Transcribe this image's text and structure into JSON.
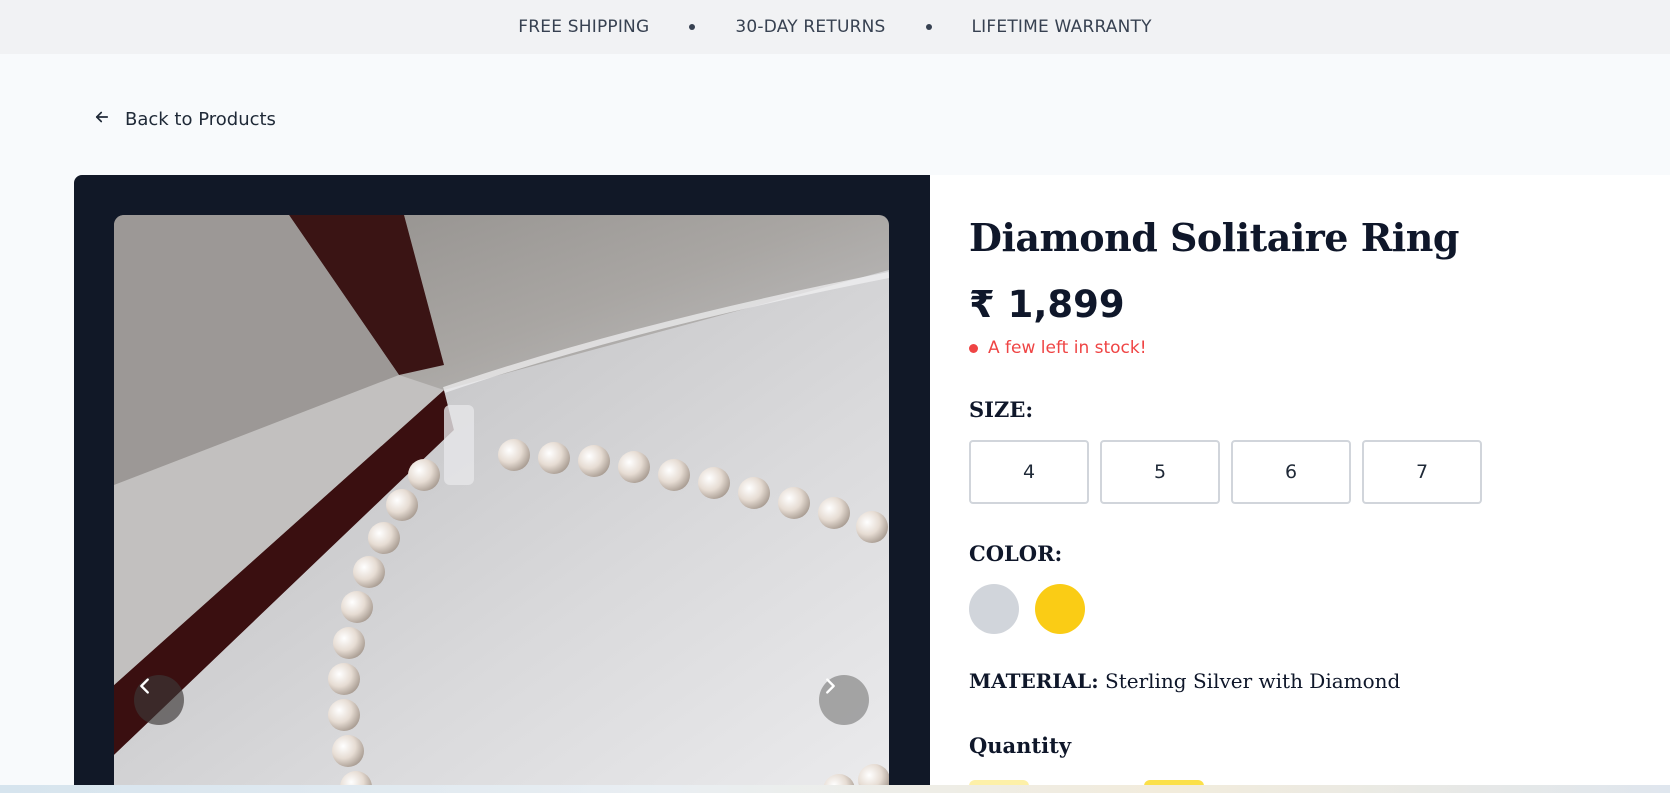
{
  "topbar": {
    "items": [
      "FREE SHIPPING",
      "30-DAY RETURNS",
      "LIFETIME WARRANTY"
    ]
  },
  "back_link": {
    "label": "Back to Products"
  },
  "product": {
    "title": "Diamond Solitaire Ring",
    "price": "₹ 1,899",
    "stock_status": "A few left in stock!",
    "size_label": "SIZE:",
    "sizes": [
      "4",
      "5",
      "6",
      "7"
    ],
    "color_label": "COLOR:",
    "colors": [
      {
        "name": "silver",
        "hex": "#d1d5db"
      },
      {
        "name": "gold",
        "hex": "#facc15"
      }
    ],
    "material_label": "MATERIAL:",
    "material_value": "Sterling Silver with Diamond",
    "quantity_label": "Quantity"
  },
  "gallery": {
    "prev_icon": "chevron-left-icon",
    "next_icon": "chevron-right-icon"
  },
  "theme": {
    "accent_dark": "#111827",
    "stock_red": "#ef4444"
  }
}
